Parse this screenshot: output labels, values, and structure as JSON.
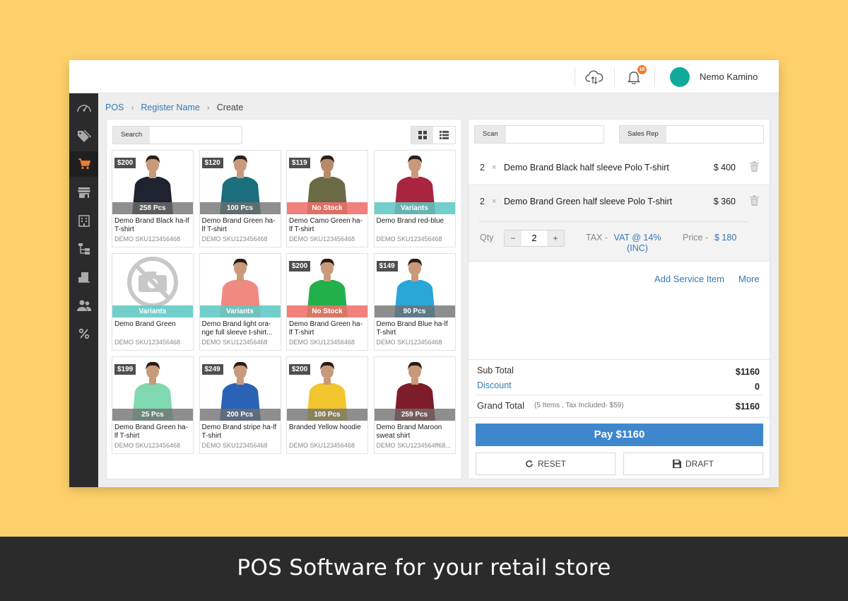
{
  "header": {
    "notification_count": "18",
    "user_name": "Nemo Kamino",
    "colors": {
      "avatar": "#11a99a",
      "badge": "#ef7d2d"
    }
  },
  "sidebar": {
    "items": [
      {
        "name": "dashboard",
        "icon": "speedometer-icon"
      },
      {
        "name": "tags",
        "icon": "tag-icon"
      },
      {
        "name": "pos",
        "icon": "cart-icon",
        "active": true
      },
      {
        "name": "store",
        "icon": "store-icon"
      },
      {
        "name": "building",
        "icon": "building-icon"
      },
      {
        "name": "hierarchy",
        "icon": "tree-icon"
      },
      {
        "name": "inventory",
        "icon": "box-icon"
      },
      {
        "name": "customers",
        "icon": "users-icon"
      },
      {
        "name": "discounts",
        "icon": "percent-icon"
      }
    ]
  },
  "breadcrumb": {
    "root": "POS",
    "register": "Register Name",
    "current": "Create"
  },
  "products_panel": {
    "search_label": "Search",
    "search_value": "",
    "products": [
      {
        "price": "$200",
        "status": "258 Pcs",
        "status_type": "stock",
        "name": "Demo Brand Black ha-lf T-shirt",
        "sku": "DEMO SKU123456468",
        "shirt_color": "#1f2330",
        "skin": "#c89a7a"
      },
      {
        "price": "$120",
        "status": "100 Pcs",
        "status_type": "stock",
        "name": "Demo Brand Green ha-lf T-shirt",
        "sku": "DEMO SKU123456468",
        "shirt_color": "#1b6f7c",
        "skin": "#c89a7a"
      },
      {
        "price": "$119",
        "status": "No Stock",
        "status_type": "none",
        "name": "Demo Camo Green ha-lf T-shirt",
        "sku": "DEMO SKU123456468",
        "shirt_color": "#6a6a44",
        "skin": "#b88a6a"
      },
      {
        "price": "",
        "status": "Variants",
        "status_type": "variants",
        "name": "Demo Brand red-blue",
        "sku": "DEMO SKU123456468",
        "shirt_color": "#a8243f",
        "skin": "#c89a7a"
      },
      {
        "price": "",
        "status": "Variants",
        "status_type": "variants",
        "name": "Demo Brand Green",
        "sku": "DEMO SKU123456468",
        "shirt_color": "",
        "skin": "",
        "no_image": true
      },
      {
        "price": "",
        "status": "Variants",
        "status_type": "variants",
        "name": "Demo Brand light ora-nge full sleeve t-shirt...",
        "sku": "DEMO SKU123456468",
        "shirt_color": "#f08a80",
        "skin": "#c89a7a"
      },
      {
        "price": "$200",
        "status": "No Stock",
        "status_type": "none",
        "name": "Demo Brand Green ha-lf T-shirt",
        "sku": "DEMO SKU123456468",
        "shirt_color": "#22b04a",
        "skin": "#c89a7a"
      },
      {
        "price": "$149",
        "status": "90 Pcs",
        "status_type": "stock",
        "name": "Demo Brand Blue ha-lf T-shirt",
        "sku": "DEMO SKU123456468",
        "shirt_color": "#2ba6d8",
        "skin": "#c89a7a"
      },
      {
        "price": "$199",
        "status": "25 Pcs",
        "status_type": "stock",
        "name": "Demo Brand Green ha-lf T-shirt",
        "sku": "DEMO SKU123456468",
        "shirt_color": "#7fd8b0",
        "skin": "#c89a7a"
      },
      {
        "price": "$249",
        "status": "200 Pcs",
        "status_type": "stock",
        "name": "Demo Brand stripe ha-lf T-shirt",
        "sku": "DEMO SKU123456468",
        "shirt_color": "#2a62b6",
        "skin": "#c89a7a"
      },
      {
        "price": "$200",
        "status": "100 Pcs",
        "status_type": "stock",
        "name": "Branded Yellow hoodie",
        "sku": "DEMO SKU123456468",
        "shirt_color": "#f1c62e",
        "skin": "#c89a7a"
      },
      {
        "price": "",
        "status": "259 Pcs",
        "status_type": "stock",
        "name": "Demo Brand Maroon sweat shirt",
        "sku": "DEMO SKU1234564ff68...",
        "shirt_color": "#7e1d2a",
        "skin": "#c89a7a"
      }
    ]
  },
  "cart_panel": {
    "scan_label": "Scan",
    "scan_value": "",
    "sales_rep_label": "Sales Rep",
    "sales_rep_value": "",
    "items": [
      {
        "qty": "2",
        "x": "×",
        "name": "Demo Brand Black half sleeve Polo T-shirt",
        "price": "$ 400"
      },
      {
        "qty": "2",
        "x": "×",
        "name": "Demo Brand Green half sleeve Polo T-shirt",
        "price": "$ 360"
      }
    ],
    "details": {
      "qty_label": "Qty",
      "qty_value": "2",
      "minus": "−",
      "plus": "+",
      "tax_label": "TAX -",
      "tax_value": "VAT @ 14% (INC)",
      "price_label": "Price -",
      "price_value": "$ 180"
    },
    "add_service_item": "Add Service Item",
    "more": "More",
    "subtotal_label": "Sub Total",
    "subtotal_value": "$1160",
    "discount_label": "Discount",
    "discount_value": "0",
    "grand_total_label": "Grand Total",
    "grand_total_note": "(5 Items , Tax Included- $59)",
    "grand_total_value": "$1160",
    "pay_label": "Pay $1160",
    "reset_label": "RESET",
    "draft_label": "DRAFT",
    "colors": {
      "pay": "#3f87cd",
      "link": "#3478b6"
    }
  },
  "footer": {
    "caption": "POS Software for your retail store"
  },
  "colors": {
    "background": "#fdd06b",
    "sidebar": "#2b2b2b",
    "cart_accent": "#ef7d2d"
  }
}
